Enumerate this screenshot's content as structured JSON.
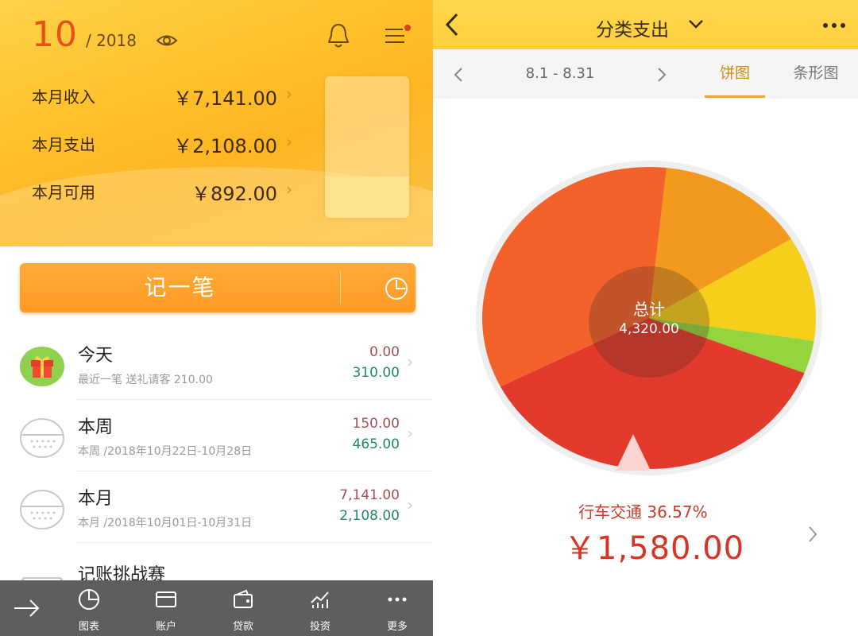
{
  "left": {
    "month": "10",
    "year": "/ 2018",
    "stats": [
      {
        "label": "本月收入",
        "value": "￥7,141.00"
      },
      {
        "label": "本月支出",
        "value": "￥2,108.00"
      },
      {
        "label": "本月可用",
        "value": "￥892.00"
      }
    ],
    "budget_remaining_fraction": 0.29,
    "record_button": "记一笔",
    "rows": [
      {
        "title": "今天",
        "sub": "最近一笔 送礼请客 210.00",
        "v1": "0.00",
        "v2": "310.00",
        "icon": "gift-icon"
      },
      {
        "title": "本周",
        "sub": "本周 /2018年10月22日-10月28日",
        "v1": "150.00",
        "v2": "465.00",
        "icon": "calendar-icon"
      },
      {
        "title": "本月",
        "sub": "本月 /2018年10月01日-10月31日",
        "v1": "7,141.00",
        "v2": "2,108.00",
        "icon": "calendar-icon"
      },
      {
        "title": "记账挑战赛",
        "sub": "",
        "v1": "",
        "v2": "",
        "icon": "envelope-icon"
      }
    ],
    "nav": [
      {
        "label": "图表",
        "icon": "pie-chart-icon"
      },
      {
        "label": "账户",
        "icon": "card-icon"
      },
      {
        "label": "贷款",
        "icon": "wallet-icon"
      },
      {
        "label": "投资",
        "icon": "trend-icon"
      },
      {
        "label": "更多",
        "icon": "more-icon"
      }
    ],
    "colors": {
      "accent": "#e5521b",
      "income": "#a55158",
      "expense": "#20896a"
    }
  },
  "right": {
    "title": "分类支出",
    "range": "8.1 - 8.31",
    "tabs": {
      "pie": "饼图",
      "bar": "条形图"
    },
    "center_label": "总计",
    "center_value": "4,320.00",
    "selected": {
      "name": "行车交通 36.57%",
      "amount": "￥1,580.00"
    }
  },
  "chart_data": {
    "type": "pie",
    "total": 4320.0,
    "slices": [
      {
        "value": 0.1457,
        "color": "#f39a1e"
      },
      {
        "value": 0.112,
        "color": "#f6cf1c"
      },
      {
        "value": 0.035,
        "color": "#94d43c"
      },
      {
        "value": 0.3657,
        "color": "#e23a2c",
        "selected": true
      },
      {
        "value": 0.3416,
        "color": "#f2622a"
      }
    ]
  }
}
